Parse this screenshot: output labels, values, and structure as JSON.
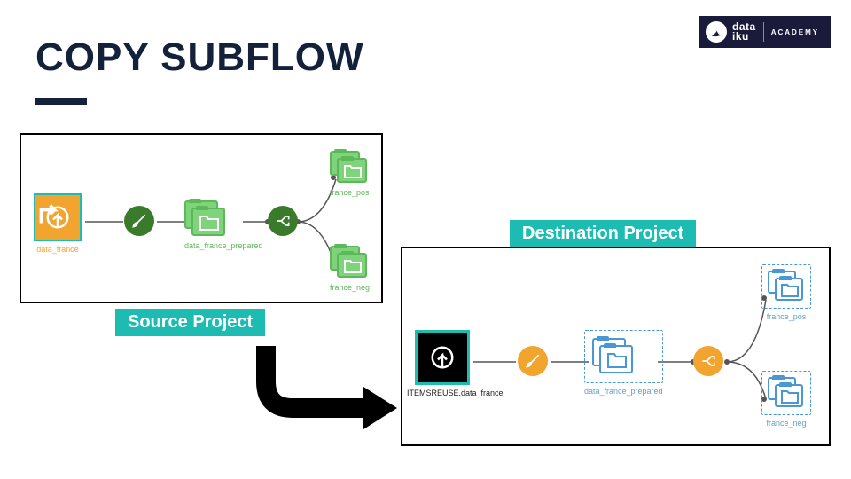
{
  "title": "COPY SUBFLOW",
  "badge": {
    "brand": "data\niku",
    "sub": "ACADEMY"
  },
  "labels": {
    "source": "Source Project",
    "destination": "Destination Project"
  },
  "source": {
    "shared_dataset": "data_france",
    "prepared": "data_france_prepared",
    "out_pos": "france_pos",
    "out_neg": "france_neg"
  },
  "destination": {
    "shared_dataset": "ITEMSREUSE.data_france",
    "prepared": "data_france_prepared",
    "out_pos": "france_pos",
    "out_neg": "france_neg"
  },
  "icons": {
    "shared": "shared-dataset-icon",
    "prepare": "prepare-broom-icon",
    "split": "split-icon",
    "folder": "folder-icon"
  }
}
